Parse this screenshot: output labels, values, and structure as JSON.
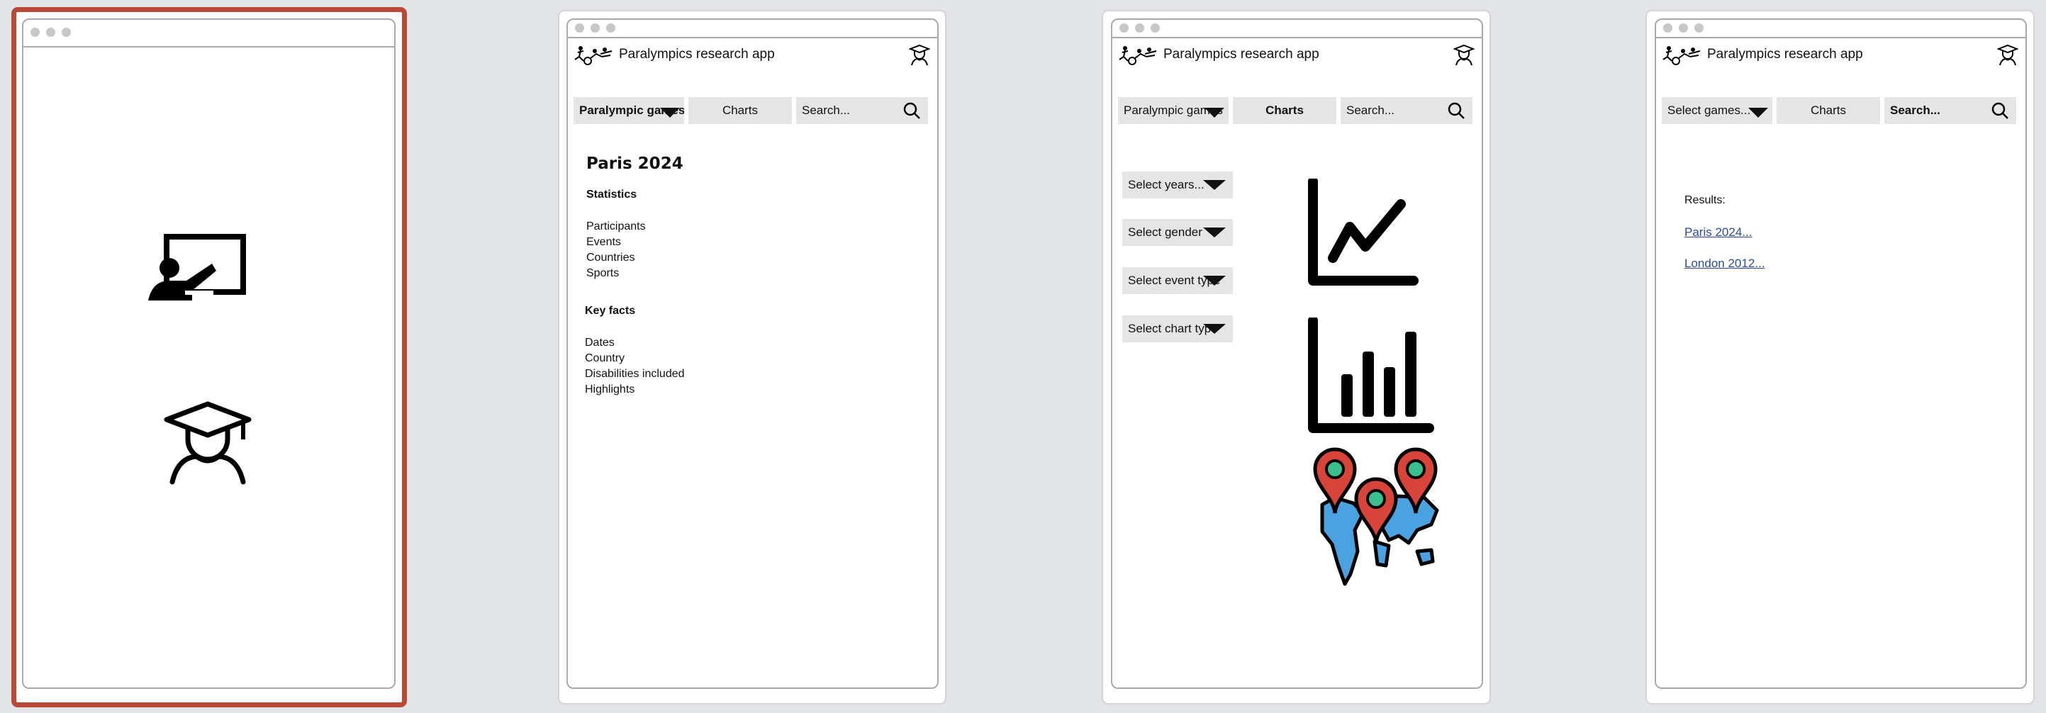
{
  "app": {
    "title": "Paralympics research app"
  },
  "screen1": {
    "icons": [
      "teacher-icon",
      "student-icon"
    ]
  },
  "screen2": {
    "nav": {
      "games_label": "Paralympic games",
      "charts_label": "Charts",
      "search_placeholder": "Search..."
    },
    "heading": "Paris 2024",
    "statistics_title": "Statistics",
    "statistics": [
      "Participants",
      "Events",
      "Countries",
      "Sports"
    ],
    "keyfacts_title": "Key facts",
    "keyfacts": [
      "Dates",
      "Country",
      "Disabilities included",
      "Highlights"
    ]
  },
  "screen3": {
    "nav": {
      "games_label": "Paralympic games",
      "charts_label": "Charts",
      "search_placeholder": "Search..."
    },
    "filters": [
      "Select years...",
      "Select gender",
      "Select event type",
      "Select chart type"
    ],
    "chart_icons": [
      "line-chart-icon",
      "bar-chart-icon",
      "world-map-pins-icon"
    ]
  },
  "screen4": {
    "nav": {
      "games_label": "Select games...",
      "charts_label": "Charts",
      "search_placeholder": "Search..."
    },
    "results_label": "Results:",
    "results": [
      "Paris 2024...",
      "London 2012..."
    ]
  },
  "colors": {
    "selected_border": "#b94a35",
    "button_bg": "#e5e5e5",
    "link": "#2a4b9b",
    "pin_red": "#d9443a",
    "map_blue": "#4aa3e0",
    "pin_green": "#3bbf8e"
  }
}
